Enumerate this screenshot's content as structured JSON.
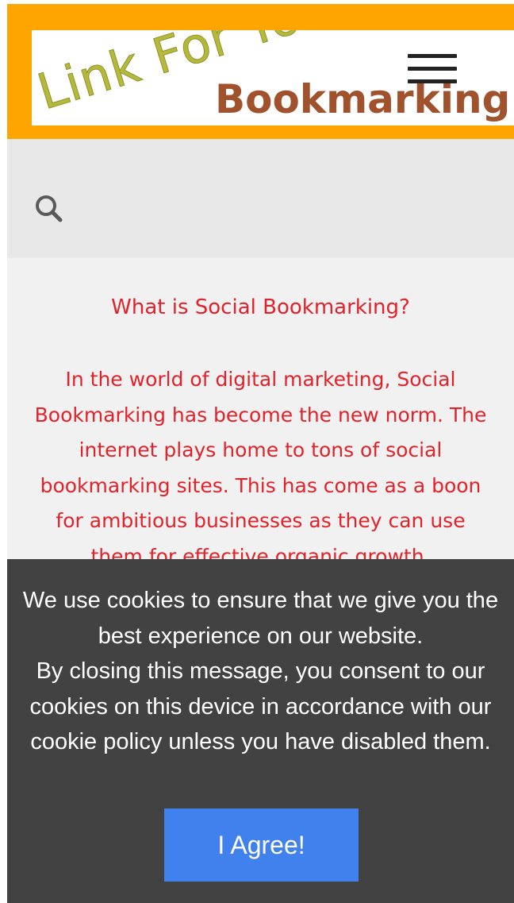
{
  "header": {
    "logo_main": "Link For You",
    "logo_sub": "Bookmarking",
    "menu_icon": "hamburger-menu-icon",
    "colors": {
      "bar": "#ffa500",
      "logo_sub": "#a0522d"
    }
  },
  "search": {
    "icon": "search-icon"
  },
  "content": {
    "heading": "What is Social Bookmarking?",
    "paragraph": "In the world of digital marketing, Social Bookmarking has become the new norm. The internet plays home to tons of social bookmarking sites. This has come as a boon for ambitious businesses as they can use them for effective organic growth.",
    "text_color": "#e0232b"
  },
  "cookie_banner": {
    "line1": "We use cookies to ensure that we give you the best experience on our website.",
    "line2": "By closing this message, you consent to our cookies on this device in accordance with our cookie policy unless you have disabled them.",
    "agree_label": "I Agree!",
    "colors": {
      "background": "#424242",
      "button": "#4081ee"
    }
  }
}
